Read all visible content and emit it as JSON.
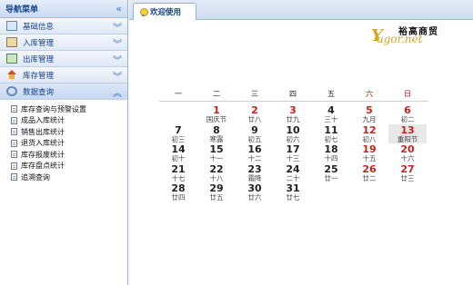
{
  "sidebar": {
    "title": "导航菜单",
    "items": [
      {
        "label": "基础信息",
        "icon": "info-card-icon"
      },
      {
        "label": "入库管理",
        "icon": "inbound-icon"
      },
      {
        "label": "出库管理",
        "icon": "outbound-icon"
      },
      {
        "label": "库存管理",
        "icon": "home-icon"
      },
      {
        "label": "数据查询",
        "icon": "search-icon"
      }
    ],
    "sub_items": [
      "库存查询与预警设置",
      "成品入库统计",
      "销售出库统计",
      "退货入库统计",
      "库存报废统计",
      "库存盘点统计",
      "追溯查询"
    ]
  },
  "tab": {
    "label": "欢迎使用"
  },
  "logo": {
    "cn": "裕高商贸",
    "en": "ugor.net",
    "y": "Y"
  },
  "calendar": {
    "weekdays": [
      "一",
      "二",
      "三",
      "四",
      "五",
      "六",
      "日"
    ],
    "weeks": [
      [
        {
          "n": "",
          "l": ""
        },
        {
          "n": "1",
          "l": "国庆节",
          "red": true
        },
        {
          "n": "2",
          "l": "廿八",
          "red": true
        },
        {
          "n": "3",
          "l": "廿九",
          "red": true
        },
        {
          "n": "4",
          "l": "三十"
        },
        {
          "n": "5",
          "l": "九月",
          "red": true
        },
        {
          "n": "6",
          "l": "初二",
          "red": true
        }
      ],
      [
        {
          "n": "7",
          "l": "初三"
        },
        {
          "n": "8",
          "l": "寒露"
        },
        {
          "n": "9",
          "l": "初五"
        },
        {
          "n": "10",
          "l": "初六"
        },
        {
          "n": "11",
          "l": "初七"
        },
        {
          "n": "12",
          "l": "初八",
          "red": true
        },
        {
          "n": "13",
          "l": "重阳节",
          "red": true,
          "today": true
        }
      ],
      [
        {
          "n": "14",
          "l": "初十"
        },
        {
          "n": "15",
          "l": "十一"
        },
        {
          "n": "16",
          "l": "十二"
        },
        {
          "n": "17",
          "l": "十三"
        },
        {
          "n": "18",
          "l": "十四"
        },
        {
          "n": "19",
          "l": "十五",
          "red": true
        },
        {
          "n": "20",
          "l": "十六",
          "red": true
        }
      ],
      [
        {
          "n": "21",
          "l": "十七"
        },
        {
          "n": "22",
          "l": "十八"
        },
        {
          "n": "23",
          "l": "霜降"
        },
        {
          "n": "24",
          "l": "二十"
        },
        {
          "n": "25",
          "l": "廿一"
        },
        {
          "n": "26",
          "l": "廿二",
          "red": true
        },
        {
          "n": "27",
          "l": "廿三",
          "red": true
        }
      ],
      [
        {
          "n": "28",
          "l": "廿四"
        },
        {
          "n": "29",
          "l": "廿五"
        },
        {
          "n": "30",
          "l": "廿六"
        },
        {
          "n": "31",
          "l": "廿七"
        },
        {
          "n": "",
          "l": ""
        },
        {
          "n": "",
          "l": ""
        },
        {
          "n": "",
          "l": ""
        }
      ]
    ]
  }
}
